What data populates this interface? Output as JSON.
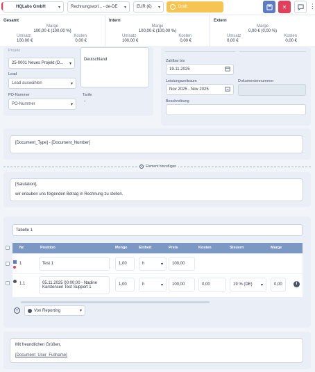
{
  "topbar": {
    "logo_letter": "H",
    "company": "HQLabs GmbH",
    "template": "Rechnungsvorl... - de-DE",
    "currency": "EUR (€)",
    "status": "Draft"
  },
  "summary": {
    "columns": [
      {
        "title": "Gesamt",
        "marge_label": "Marge",
        "marge_value": "100,00 € (100,00 %)",
        "umsatz_label": "Umsatz",
        "umsatz_value": "100,00 €",
        "kosten_label": "Kosten",
        "kosten_value": "0,00 €"
      },
      {
        "title": "Intern",
        "marge_label": "Marge",
        "marge_value": "100,00 € (100,00 %)",
        "umsatz_label": "Umsatz",
        "umsatz_value": "100,00 €",
        "kosten_label": "Kosten",
        "kosten_value": "0,00 €"
      },
      {
        "title": "Extern",
        "marge_label": "Marge",
        "marge_value": "0,00 € (0,00 %)",
        "umsatz_label": "Umsatz",
        "umsatz_value": "0,00 €",
        "kosten_label": "Kosten",
        "kosten_value": "0,00 €"
      }
    ]
  },
  "form": {
    "projekt_label": "Projekt",
    "projekt_value": "25-0001 Neues Projekt (D...",
    "address_line": "Deutschland",
    "lead_label": "Lead",
    "lead_placeholder": "Lead auswählen",
    "po_label": "PO-Nummer",
    "po_placeholder": "PO-Nummer",
    "tarife_label": "Tarife",
    "tarife_value": "-",
    "zahlbar_label": "Zahlbar bis",
    "zahlbar_value": "19.11.2025",
    "leistung_label": "Leistungszeitraum",
    "leistung_value": "Nov 2025 - Nov 2025",
    "docnum_label": "Dokumentennummer",
    "beschreibung_label": "Beschreibung"
  },
  "doc_title": "[Document_Type] - [Document_Number]",
  "add_element": "Element hinzufügen",
  "intro": {
    "salutation": "[Salutation],",
    "text": "wir erlauben uns folgenden Betrag in Rechnung zu stellen."
  },
  "table": {
    "name": "Tabelle 1",
    "headers": [
      "Nr.",
      "Position",
      "Menge",
      "Einheit",
      "Preis",
      "Kosten",
      "Steuern",
      "Marge"
    ],
    "rows": [
      {
        "nr": "1",
        "position": "Test 1",
        "menge": "1,00",
        "einheit": "h",
        "preis": "100,00"
      },
      {
        "nr": "1.1",
        "position_line1": "05.11.2025 00:00:00 - Nadine",
        "position_line2": "Karstensen Test Support 1",
        "menge": "1,00",
        "einheit": "h",
        "preis": "100,00",
        "kosten": "0,00",
        "steuern": "19 % (DE)",
        "marge": "0,00"
      }
    ],
    "add_from": "Von Reporting"
  },
  "closing": {
    "text": "Mit freundlichen Grüßen,",
    "signature": "[Document_User_Fullname]"
  },
  "colors": {
    "accent": "#5b7cc4",
    "danger": "#e53e5a",
    "draft": "#f6c453"
  }
}
